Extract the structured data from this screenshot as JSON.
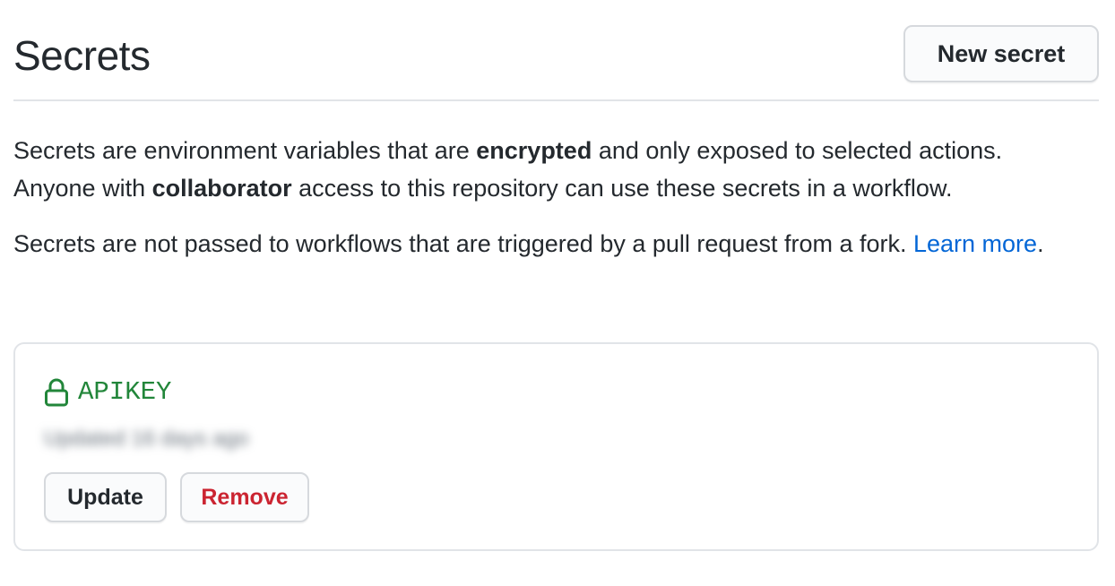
{
  "header": {
    "title": "Secrets",
    "new_secret_label": "New secret"
  },
  "description": {
    "p1_part1": "Secrets are environment variables that are ",
    "p1_bold1": "encrypted",
    "p1_part2": " and only exposed to selected actions. Anyone with ",
    "p1_bold2": "collaborator",
    "p1_part3": " access to this repository can use these secrets in a workflow.",
    "p2_text": "Secrets are not passed to workflows that are triggered by a pull request from a fork. ",
    "p2_link": "Learn more",
    "p2_end": "."
  },
  "secrets": [
    {
      "name": "APIKEY",
      "updated": "Updated 16 days ago",
      "icon": "lock-icon",
      "update_label": "Update",
      "remove_label": "Remove"
    }
  ],
  "colors": {
    "secret_name": "#22863a",
    "link": "#0366d6",
    "danger": "#cb2431",
    "border": "#e1e4e8"
  }
}
